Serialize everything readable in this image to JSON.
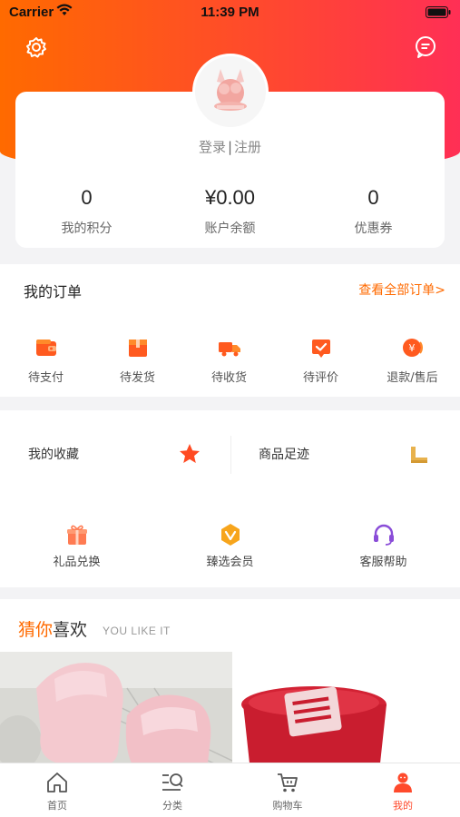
{
  "status_bar": {
    "carrier": "Carrier",
    "time": "11:39 PM"
  },
  "profile": {
    "login_label": "登录",
    "separator": "|",
    "register_label": "注册",
    "stats": [
      {
        "value": "0",
        "label": "我的积分"
      },
      {
        "value": "¥0.00",
        "label": "账户余额"
      },
      {
        "value": "0",
        "label": "优惠券"
      }
    ]
  },
  "orders": {
    "title": "我的订单",
    "view_all": "查看全部订单>",
    "items": [
      {
        "label": "待支付",
        "icon": "wallet-icon"
      },
      {
        "label": "待发货",
        "icon": "package-icon"
      },
      {
        "label": "待收货",
        "icon": "truck-icon"
      },
      {
        "label": "待评价",
        "icon": "review-icon"
      },
      {
        "label": "退款/售后",
        "icon": "refund-icon"
      }
    ]
  },
  "favorites": {
    "collection_label": "我的收藏",
    "footprint_label": "商品足迹"
  },
  "services": [
    {
      "label": "礼品兑换",
      "icon": "gift-icon"
    },
    {
      "label": "臻选会员",
      "icon": "vip-icon"
    },
    {
      "label": "客服帮助",
      "icon": "headset-icon"
    }
  ],
  "guess": {
    "title_highlight": "猜你",
    "title_rest": "喜欢",
    "subtitle": "YOU LIKE IT"
  },
  "tabbar": [
    {
      "label": "首页",
      "icon": "home-icon"
    },
    {
      "label": "分类",
      "icon": "category-search-icon"
    },
    {
      "label": "购物车",
      "icon": "cart-icon"
    },
    {
      "label": "我的",
      "icon": "user-icon"
    }
  ],
  "colors": {
    "accent": "#ff6a00",
    "gradient_end": "#ff2f55",
    "active_tab": "#ff4a2c"
  }
}
